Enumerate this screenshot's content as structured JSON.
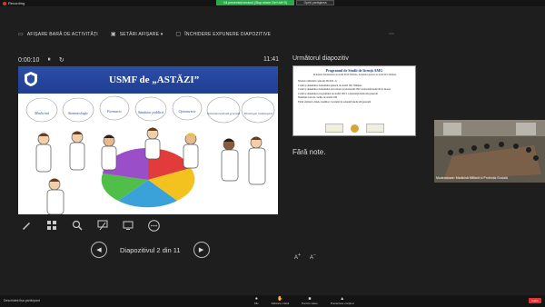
{
  "topbar": {
    "recording_label": "Recording",
    "share_banner": "Vă prezentați ecranul (Stop share Ctrl+Alt+S)",
    "stop_share_label": "Opriți partajarea"
  },
  "toolbar": {
    "show_taskbar": "AFIȘARE BARĂ DE ACTIVITĂȚI",
    "display_settings": "SETĂRI AFIȘARE ▾",
    "end_slideshow": "ÎNCHIDERE EXPUNERE DIAPOZITIVE"
  },
  "presenter": {
    "elapsed": "0:00:10",
    "clock": "11:41",
    "slide_nav_label": "Diapozitivul 2 din 11",
    "next_slide_heading": "Următorul diapozitiv",
    "notes_text": "Fără note."
  },
  "current_slide": {
    "title": "USMF de „ASTĂZI”",
    "specialties": [
      "Medicină",
      "Stomatologie",
      "Farmacie",
      "Sănătate publică",
      "Optometrie",
      "Asistență medicală generală",
      "Tehnologie radiologică"
    ],
    "colors": {
      "header": "#1f3e92",
      "label": "#2b4ea8"
    }
  },
  "next_slide": {
    "title": "Programul de Studii de licență AMG",
    "subtitle": "Domeniul fundamental de studii 0910 Sănătate, domeniul general de studii 091 Sănătate",
    "lines": [
      "Nivelul calificării conform ISCED - 6",
      "Codul și denumirea domeniului general de studii: 091 Sănătate",
      "Codul și denumirea domeniului de formare profesională: 0913 Asistență medicală și moașe",
      "Codul și denumirea programului de studii: 0913.1 Asistență medicală generală",
      "Numărul total de credite de studii: 240",
      "Titlul obținut la finele studiilor: Licențiat în asistență medicală generală"
    ]
  },
  "camera": {
    "label": "Moderatoare: Medicină Militară și Protecția Socială"
  },
  "bottombar": {
    "left_label": "Deschideți fișa participant",
    "buttons": [
      {
        "icon": "mic-icon",
        "label": "Mic"
      },
      {
        "icon": "hand-icon",
        "label": "Ridicare mână"
      },
      {
        "icon": "camera-icon",
        "label": "Pornire video"
      },
      {
        "icon": "share-icon",
        "label": "Prezentare conținut"
      }
    ],
    "end_label": "Ieșire"
  }
}
